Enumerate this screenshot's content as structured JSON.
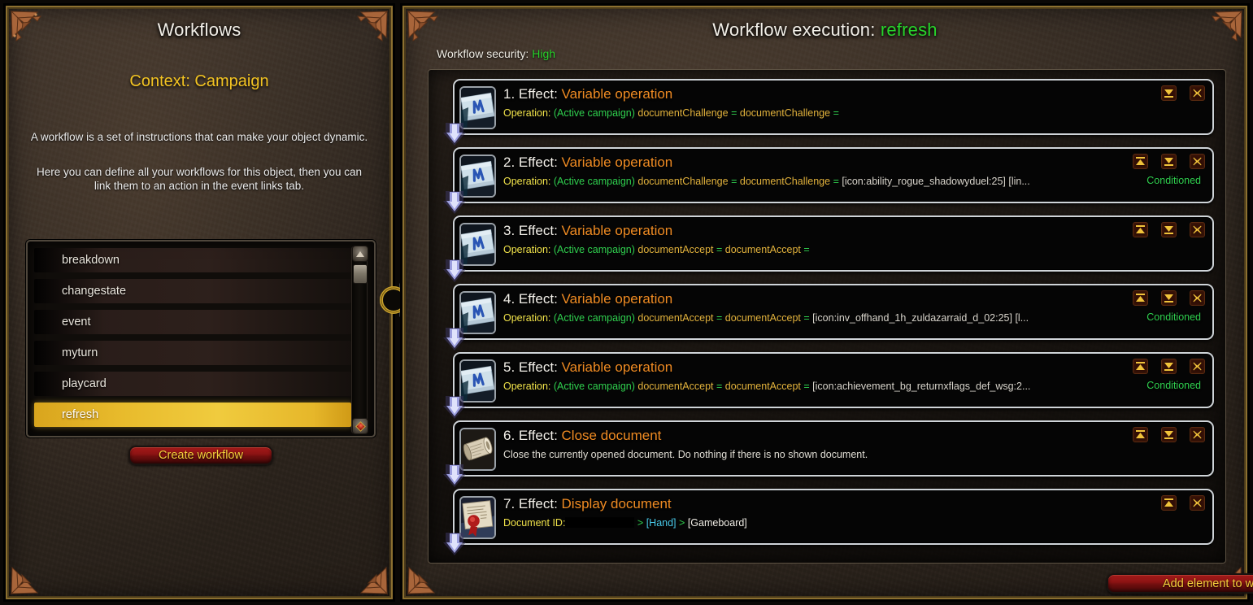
{
  "left_panel": {
    "title": "Workflows",
    "context_title": "Context: Campaign",
    "description_line1": "A workflow is a set of instructions that can make your object dynamic.",
    "description_line2": "Here you can define all your workflows for this object, then you can link them to an action in the event links tab.",
    "workflows": [
      {
        "name": "breakdown",
        "selected": false
      },
      {
        "name": "changestate",
        "selected": false
      },
      {
        "name": "event",
        "selected": false
      },
      {
        "name": "myturn",
        "selected": false
      },
      {
        "name": "playcard",
        "selected": false
      },
      {
        "name": "refresh",
        "selected": true
      }
    ],
    "create_button": "Create workflow"
  },
  "right_panel": {
    "title_prefix": "Workflow execution:",
    "title_value": "refresh",
    "security_label": "Workflow security:",
    "security_value": "High",
    "add_button": "Add element to workflow",
    "conditioned_label": "Conditioned",
    "effects": [
      {
        "index": "1.",
        "effect_word": "Effect:",
        "name": "Variable operation",
        "icon": "scroll-rune-icon",
        "op_label": "Operation:",
        "op_context": "(Active campaign)",
        "op_var1": "documentChallenge",
        "op_eq1": "=",
        "op_var2": "documentChallenge",
        "op_eq2": "=",
        "op_tail": "",
        "conditioned": false,
        "has_up": false,
        "has_down": true,
        "has_delete": true
      },
      {
        "index": "2.",
        "effect_word": "Effect:",
        "name": "Variable operation",
        "icon": "scroll-rune-icon",
        "op_label": "Operation:",
        "op_context": "(Active campaign)",
        "op_var1": "documentChallenge",
        "op_eq1": "=",
        "op_var2": "documentChallenge",
        "op_eq2": "=",
        "op_tail": "[icon:ability_rogue_shadowyduel:25] [lin...",
        "conditioned": true,
        "has_up": true,
        "has_down": true,
        "has_delete": true
      },
      {
        "index": "3.",
        "effect_word": "Effect:",
        "name": "Variable operation",
        "icon": "scroll-rune-icon",
        "op_label": "Operation:",
        "op_context": "(Active campaign)",
        "op_var1": "documentAccept",
        "op_eq1": "=",
        "op_var2": "documentAccept",
        "op_eq2": "=",
        "op_tail": "",
        "conditioned": false,
        "has_up": true,
        "has_down": true,
        "has_delete": true
      },
      {
        "index": "4.",
        "effect_word": "Effect:",
        "name": "Variable operation",
        "icon": "scroll-rune-icon",
        "op_label": "Operation:",
        "op_context": "(Active campaign)",
        "op_var1": "documentAccept",
        "op_eq1": "=",
        "op_var2": "documentAccept",
        "op_eq2": "=",
        "op_tail": "[icon:inv_offhand_1h_zuldazarraid_d_02:25] [l...",
        "conditioned": true,
        "has_up": true,
        "has_down": true,
        "has_delete": true
      },
      {
        "index": "5.",
        "effect_word": "Effect:",
        "name": "Variable operation",
        "icon": "scroll-rune-icon",
        "op_label": "Operation:",
        "op_context": "(Active campaign)",
        "op_var1": "documentAccept",
        "op_eq1": "=",
        "op_var2": "documentAccept",
        "op_eq2": "=",
        "op_tail": "[icon:achievement_bg_returnxflags_def_wsg:2...",
        "conditioned": true,
        "has_up": true,
        "has_down": true,
        "has_delete": true
      },
      {
        "index": "6.",
        "effect_word": "Effect:",
        "name": "Close document",
        "icon": "rolled-scroll-icon",
        "description": "Close the currently opened document. Do nothing if there is no shown document.",
        "conditioned": false,
        "has_up": true,
        "has_down": true,
        "has_delete": true
      },
      {
        "index": "7.",
        "effect_word": "Effect:",
        "name": "Display document",
        "icon": "sealed-document-icon",
        "doc_id_label": "Document ID:",
        "doc_path_sep1": ">",
        "doc_path_node1": "[Hand]",
        "doc_path_sep2": ">",
        "doc_path_node2": "[Gameboard]",
        "conditioned": false,
        "has_up": true,
        "has_down": false,
        "has_delete": true
      }
    ]
  },
  "colors": {
    "accent_gold": "#f2c322",
    "accent_orange": "#ef8b23",
    "accent_green": "#27d32b",
    "button_red": "#8c1313",
    "frame_gold": "#8c7030"
  },
  "icons": {
    "move_top": "move-to-top-icon",
    "move_bottom": "move-to-bottom-icon",
    "delete": "delete-icon",
    "scroll_up": "scroll-up-icon",
    "scroll_down": "scroll-down-icon",
    "divider": "panel-divider-handle-icon"
  }
}
